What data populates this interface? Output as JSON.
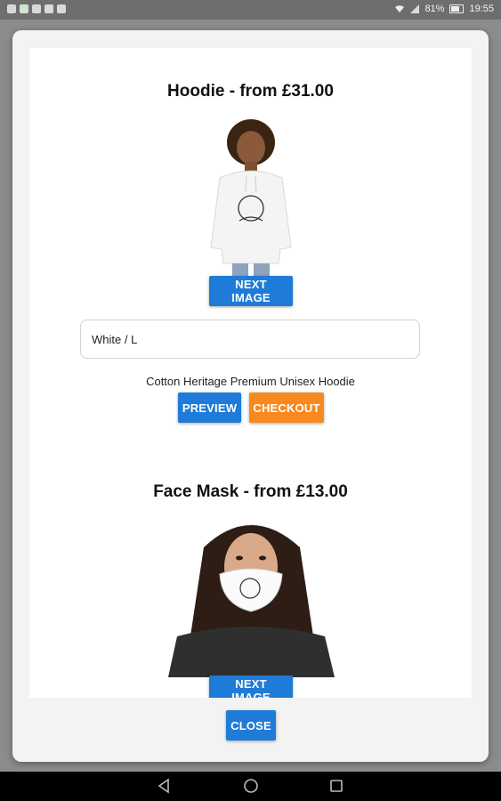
{
  "status_bar": {
    "battery": "81%",
    "time": "19:55"
  },
  "products": [
    {
      "title": "Hoodie - from £31.00",
      "next_image_label": "NEXT IMAGE",
      "variant": "White / L",
      "description": "Cotton Heritage Premium Unisex Hoodie",
      "preview_label": "PREVIEW",
      "checkout_label": "CHECKOUT"
    },
    {
      "title": "Face Mask - from £13.00",
      "next_image_label": "NEXT IMAGE"
    }
  ],
  "dialog": {
    "close_label": "CLOSE"
  },
  "colors": {
    "primary": "#1f7bd8",
    "checkout": "#f7891e"
  },
  "icons": [
    "wifi-icon",
    "signal-icon",
    "battery-icon",
    "back-icon",
    "home-icon",
    "recents-icon"
  ]
}
